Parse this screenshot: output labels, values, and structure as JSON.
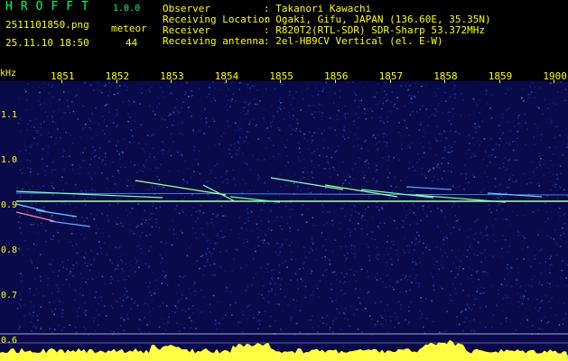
{
  "app": {
    "logo": "HROFFT",
    "version": "1.0.0",
    "filename": "2511101850.png",
    "meteor_label": "meteor",
    "datetime": "25.11.10 18:50",
    "meteor_count": "44"
  },
  "info": {
    "observer_label": "Observer",
    "observer_value": ": Takanori Kawachi",
    "location_label": "Receiving Location",
    "location_value": ": Ogaki, Gifu, JAPAN (136.60E, 35.35N)",
    "receiver_label": "Receiver",
    "receiver_value": ": R820T2(RTL-SDR) SDR-Sharp 53.372MHz",
    "antenna_label": "Receiving antenna",
    "antenna_value": ": 2el-HB9CV Vertical (el. E-W)"
  },
  "axis": {
    "unit": "kHz",
    "x_ticks": [
      "1851",
      "1852",
      "1853",
      "1854",
      "1855",
      "1856",
      "1857",
      "1858",
      "1859",
      "1900"
    ],
    "y_ticks": [
      "1.1",
      "1.0",
      "0.9",
      "0.8",
      "0.7",
      "0.6"
    ]
  },
  "colors": {
    "background": "#0a0a4a",
    "text": "#ffff00",
    "carrier": "#aaffaa",
    "baseline": "#00ffff"
  }
}
